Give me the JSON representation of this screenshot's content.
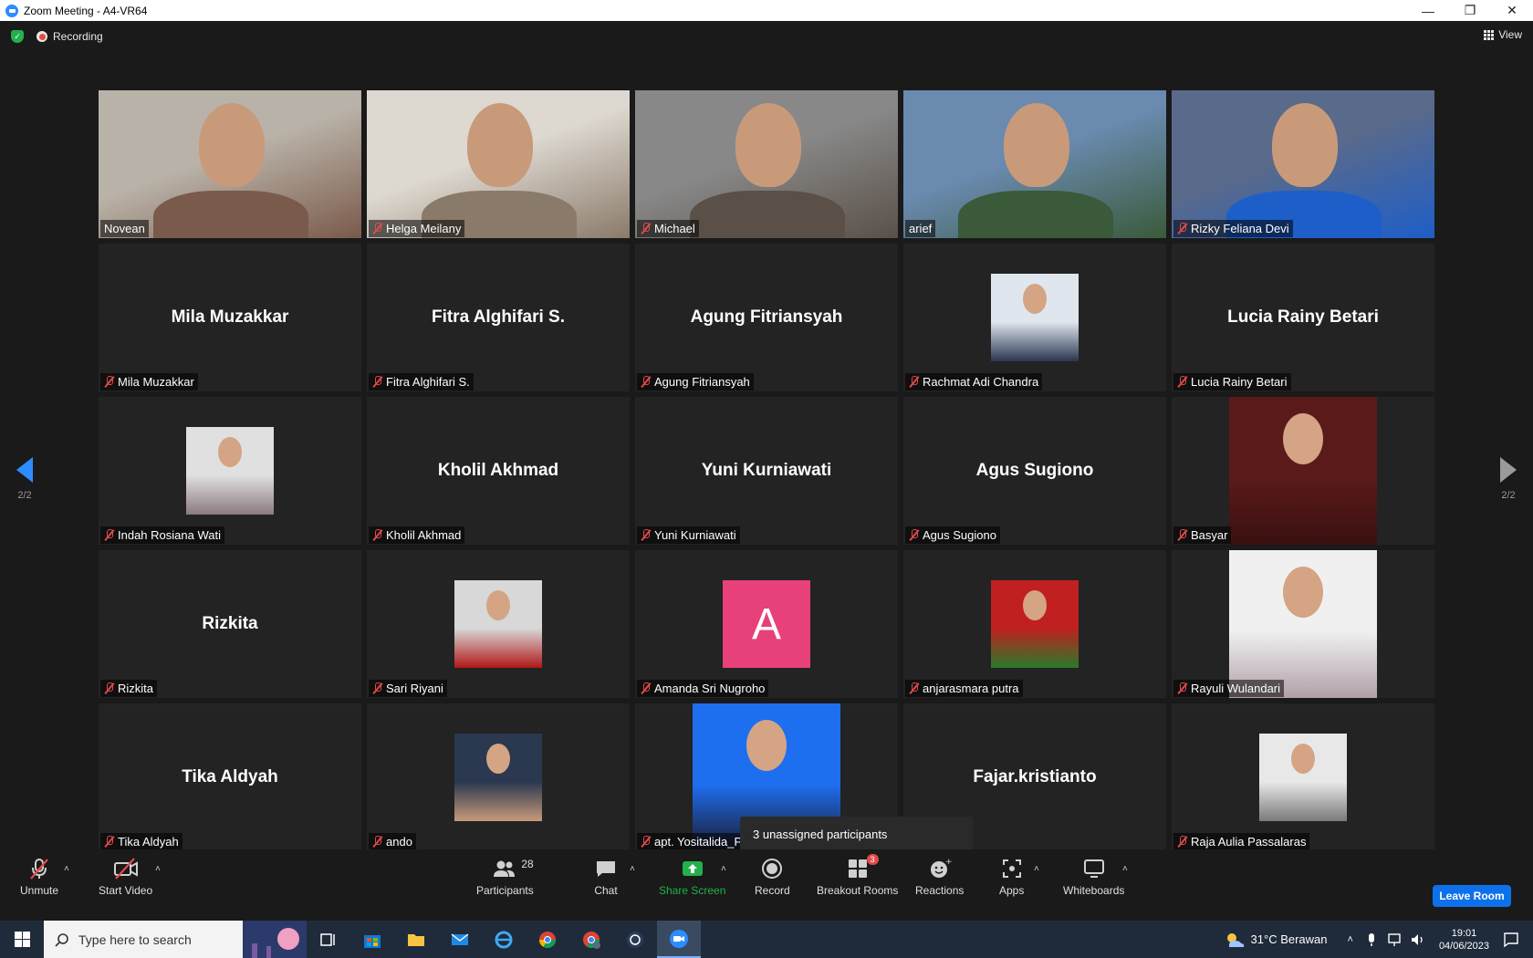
{
  "window": {
    "title": "Zoom Meeting - A4-VR64"
  },
  "top": {
    "recording_label": "Recording",
    "view_label": "View"
  },
  "nav": {
    "page_left": "2/2",
    "page_right": "2/2"
  },
  "tiles": [
    {
      "name": "Novean",
      "type": "video",
      "muted": false
    },
    {
      "name": "Helga Meilany",
      "type": "video",
      "muted": true
    },
    {
      "name": "Michael",
      "type": "video",
      "muted": true
    },
    {
      "name": "arief",
      "type": "video",
      "muted": false
    },
    {
      "name": "Rizky Feliana Devi",
      "type": "video",
      "muted": true
    },
    {
      "name": "Mila Muzakkar",
      "big": "Mila Muzakkar",
      "type": "name",
      "muted": true
    },
    {
      "name": "Fitra Alghifari S.",
      "big": "Fitra Alghifari S.",
      "type": "name",
      "muted": true
    },
    {
      "name": "Agung Fitriansyah",
      "big": "Agung Fitriansyah",
      "type": "name",
      "muted": true
    },
    {
      "name": "Rachmat Adi Chandra",
      "type": "avatar",
      "muted": true
    },
    {
      "name": "Lucia Rainy Betari",
      "big": "Lucia Rainy Betari",
      "type": "name",
      "muted": true
    },
    {
      "name": "Indah Rosiana Wati",
      "type": "avatar",
      "muted": true
    },
    {
      "name": "Kholil Akhmad",
      "big": "Kholil Akhmad",
      "type": "name",
      "muted": true
    },
    {
      "name": "Yuni Kurniawati",
      "big": "Yuni Kurniawati",
      "type": "name",
      "muted": true
    },
    {
      "name": "Agus Sugiono",
      "big": "Agus Sugiono",
      "type": "name",
      "muted": true
    },
    {
      "name": "Basyar",
      "type": "avatar-tall",
      "muted": true
    },
    {
      "name": "Rizkita",
      "big": "Rizkita",
      "type": "name",
      "muted": true
    },
    {
      "name": "Sari Riyani",
      "type": "avatar",
      "muted": true
    },
    {
      "name": "Amanda Sri Nugroho",
      "type": "letter",
      "letter": "A",
      "muted": true
    },
    {
      "name": "anjarasmara putra",
      "type": "avatar",
      "muted": true
    },
    {
      "name": "Rayuli Wulandari",
      "type": "avatar-tall",
      "muted": true
    },
    {
      "name": "Tika Aldyah",
      "big": "Tika Aldyah",
      "type": "name",
      "muted": true
    },
    {
      "name": "ando",
      "type": "avatar",
      "muted": true
    },
    {
      "name": "apt. Yositalida_P",
      "type": "avatar-tall",
      "muted": true
    },
    {
      "name": "ianto",
      "big": "Fajar.kristianto",
      "type": "name",
      "muted": false
    },
    {
      "name": "Raja Aulia Passalaras",
      "type": "avatar",
      "muted": true
    }
  ],
  "tooltip": {
    "text": "3 unassigned participants"
  },
  "toolbar": {
    "unmute": "Unmute",
    "start_video": "Start Video",
    "participants": "Participants",
    "participants_count": "28",
    "chat": "Chat",
    "share_screen": "Share Screen",
    "record": "Record",
    "breakout_rooms": "Breakout Rooms",
    "breakout_badge": "3",
    "reactions": "Reactions",
    "apps": "Apps",
    "whiteboards": "Whiteboards",
    "leave_room": "Leave Room"
  },
  "taskbar": {
    "search_placeholder": "Type here to search",
    "weather": "31°C  Berawan",
    "time": "19:01",
    "date": "04/06/2023"
  },
  "colors": {
    "accent": "#2d8cff",
    "share_green": "#22b14c",
    "mute_red": "#e34a4a",
    "letter_avatar": "#e8407a",
    "leave_blue": "#0e71eb"
  }
}
